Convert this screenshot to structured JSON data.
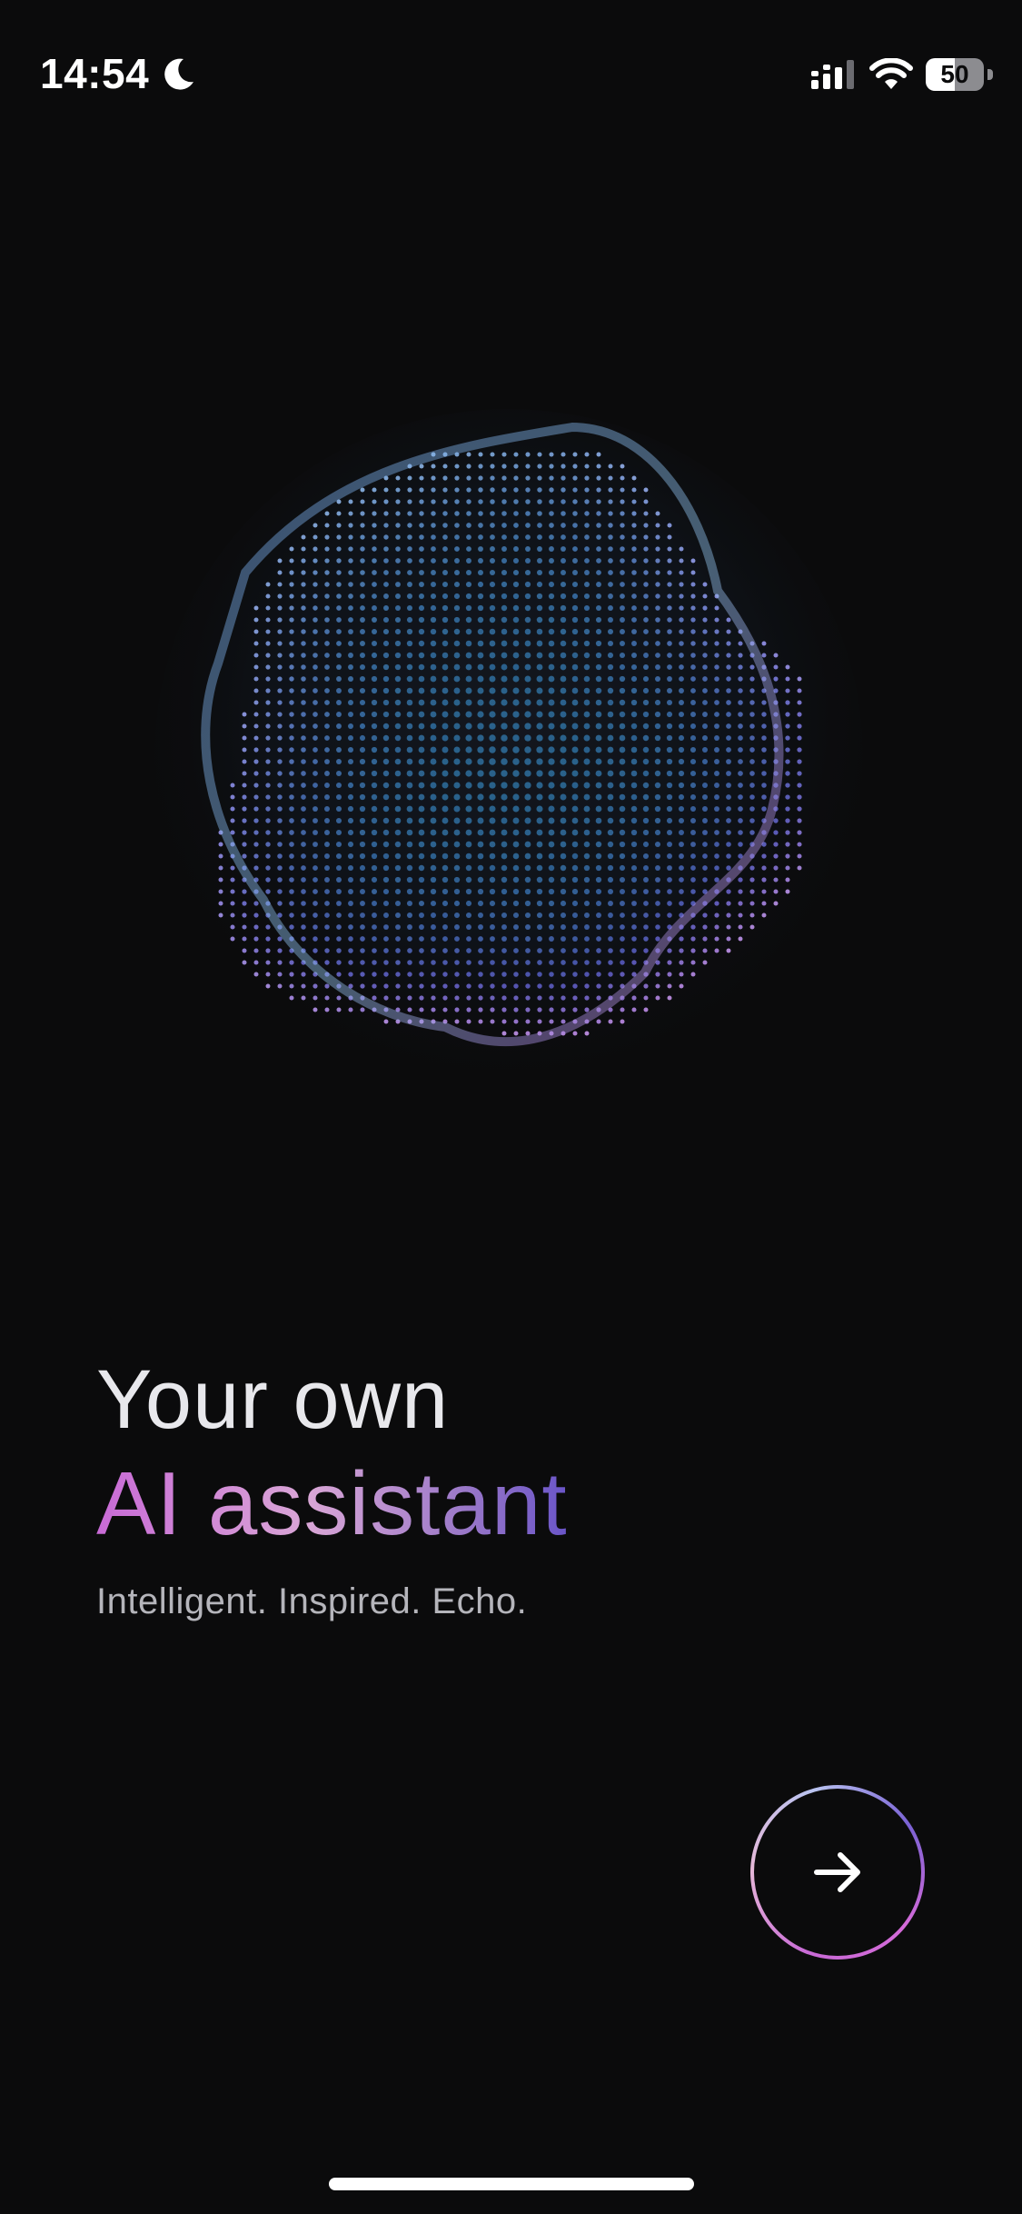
{
  "status_bar": {
    "time": "14:54",
    "battery_level": "50",
    "battery_fraction": 0.5,
    "icons": [
      "moon-icon",
      "cellular-signal-icon",
      "wifi-icon",
      "battery-icon"
    ]
  },
  "hero": {
    "illustration": "particle-orb",
    "title_line1": "Your own",
    "title_line2": "AI assistant",
    "subtitle": "Intelligent. Inspired. Echo."
  },
  "next_button": {
    "icon": "arrow-right-icon"
  },
  "colors": {
    "background": "#0b0b0c",
    "accent_pink": "#c86ad6",
    "accent_violet": "#6a55c8",
    "orb_blue": "#6fa3e8"
  }
}
